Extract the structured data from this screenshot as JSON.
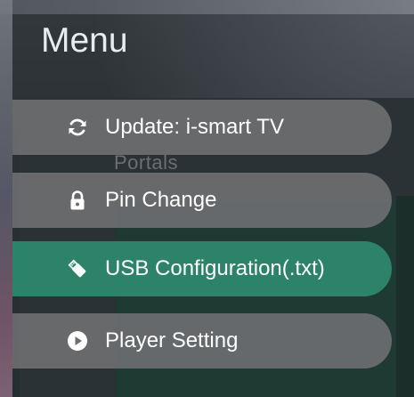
{
  "background": {
    "ghost_text": "Portals"
  },
  "menu": {
    "title": "Menu",
    "items": [
      {
        "label": "Update: i-smart TV",
        "icon": "refresh-icon",
        "active": false
      },
      {
        "label": "Pin Change",
        "icon": "lock-icon",
        "active": false
      },
      {
        "label": "USB Configuration(.txt)",
        "icon": "usb-drive-icon",
        "active": true
      },
      {
        "label": "Player Setting",
        "icon": "play-circle-icon",
        "active": false
      }
    ]
  },
  "colors": {
    "active_item": "#2c8369",
    "inactive_item": "#6c6e70",
    "text": "#ffffff"
  }
}
